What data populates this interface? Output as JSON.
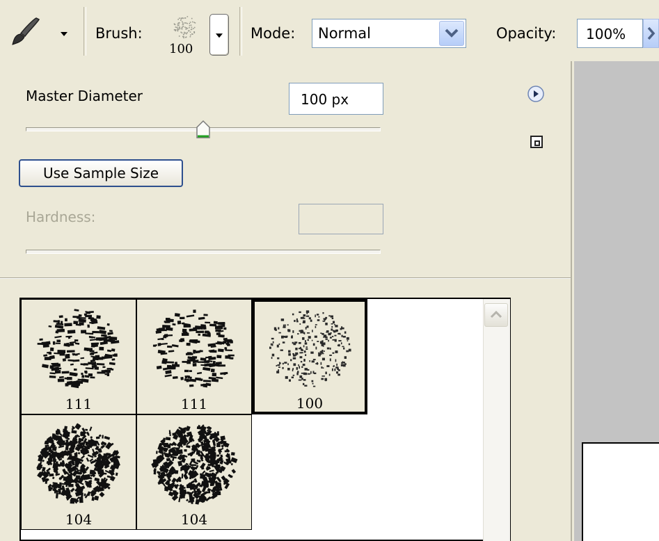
{
  "toolbar": {
    "tool_icon": "brush-icon",
    "brush_label": "Brush:",
    "brush_size": "100",
    "mode_label": "Mode:",
    "mode_value": "Normal",
    "opacity_label": "Opacity:",
    "opacity_value": "100%"
  },
  "panel": {
    "master_diameter_label": "Master Diameter",
    "master_diameter_value": "100 px",
    "master_diameter_level": 0.5,
    "use_sample_size_label": "Use Sample Size",
    "hardness_label": "Hardness:",
    "hardness_value": ""
  },
  "brushes": [
    {
      "size": "111",
      "style": "streak",
      "selected": false
    },
    {
      "size": "111",
      "style": "streak",
      "selected": false
    },
    {
      "size": "100",
      "style": "fine",
      "selected": true
    },
    {
      "size": "104",
      "style": "dense",
      "selected": false
    },
    {
      "size": "104",
      "style": "dense",
      "selected": false
    }
  ],
  "colors": {
    "panel_bg": "#ECE9D8",
    "field_border": "#7f9db9",
    "button_border": "#2d4f8e",
    "accent_blue": "#3c6cc4"
  }
}
